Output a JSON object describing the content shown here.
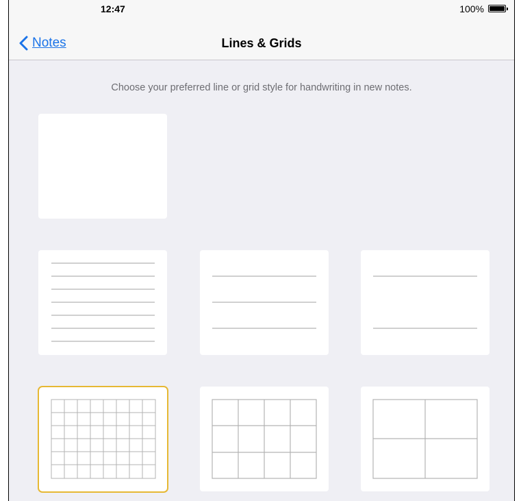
{
  "status_bar": {
    "time": "12:47",
    "battery_percent": "100%"
  },
  "nav": {
    "back_label": "Notes",
    "title": "Lines & Grids"
  },
  "instructions": "Choose your preferred line or grid style for handwriting in new notes.",
  "options": [
    {
      "style": "blank"
    },
    {
      "style": "lines-small"
    },
    {
      "style": "lines-medium"
    },
    {
      "style": "lines-large"
    },
    {
      "style": "grid-small",
      "selected": true
    },
    {
      "style": "grid-medium"
    },
    {
      "style": "grid-large"
    }
  ],
  "colors": {
    "accent": "#1a73e8",
    "selection": "#e6b833",
    "background": "#efeff4",
    "line": "#b3b3b3"
  }
}
